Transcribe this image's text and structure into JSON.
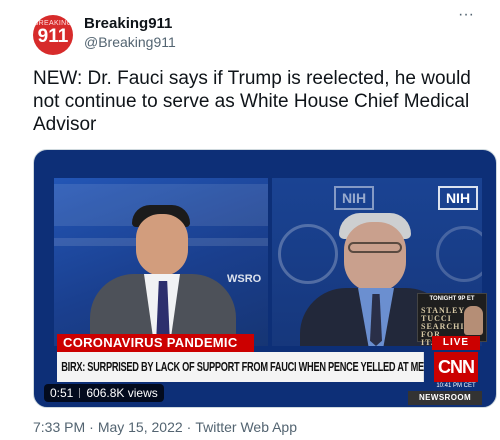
{
  "author": {
    "name": "Breaking911",
    "handle": "@Breaking911",
    "avatar_top_text": "BREAKING",
    "avatar_number": "911"
  },
  "more_label": "···",
  "tweet": {
    "text": "NEW: Dr. Fauci says if Trump is reelected, he would not continue to serve as White House Chief Medical Advisor"
  },
  "video": {
    "overlay": {
      "wall_text": "WSRO",
      "nih_label": "NIH",
      "promo_label": "TONIGHT 9P ET",
      "promo_title": "STANLEY TUCCI SEARCHING FOR ITALY",
      "chyron_tag": "CORONAVIRUS PANDEMIC",
      "chyron_main": "BIRX: SURPRISED BY LACK OF SUPPORT FROM FAUCI WHEN PENCE YELLED AT ME",
      "live_label": "LIVE",
      "network_logo": "CNN",
      "clock_text": "10:41 PM CET",
      "newsroom_label": "NEWSROOM"
    },
    "duration": "0:51",
    "views": "606.8K views"
  },
  "footer": {
    "time": "7:33 PM",
    "date": "May 15, 2022",
    "source": "Twitter Web App",
    "separator": "·"
  },
  "colors": {
    "text_primary": "#0f1419",
    "text_secondary": "#536471",
    "cnn_red": "#cc0000",
    "studio_blue": "#1a3f8e",
    "avatar_red": "#d72b2b"
  }
}
